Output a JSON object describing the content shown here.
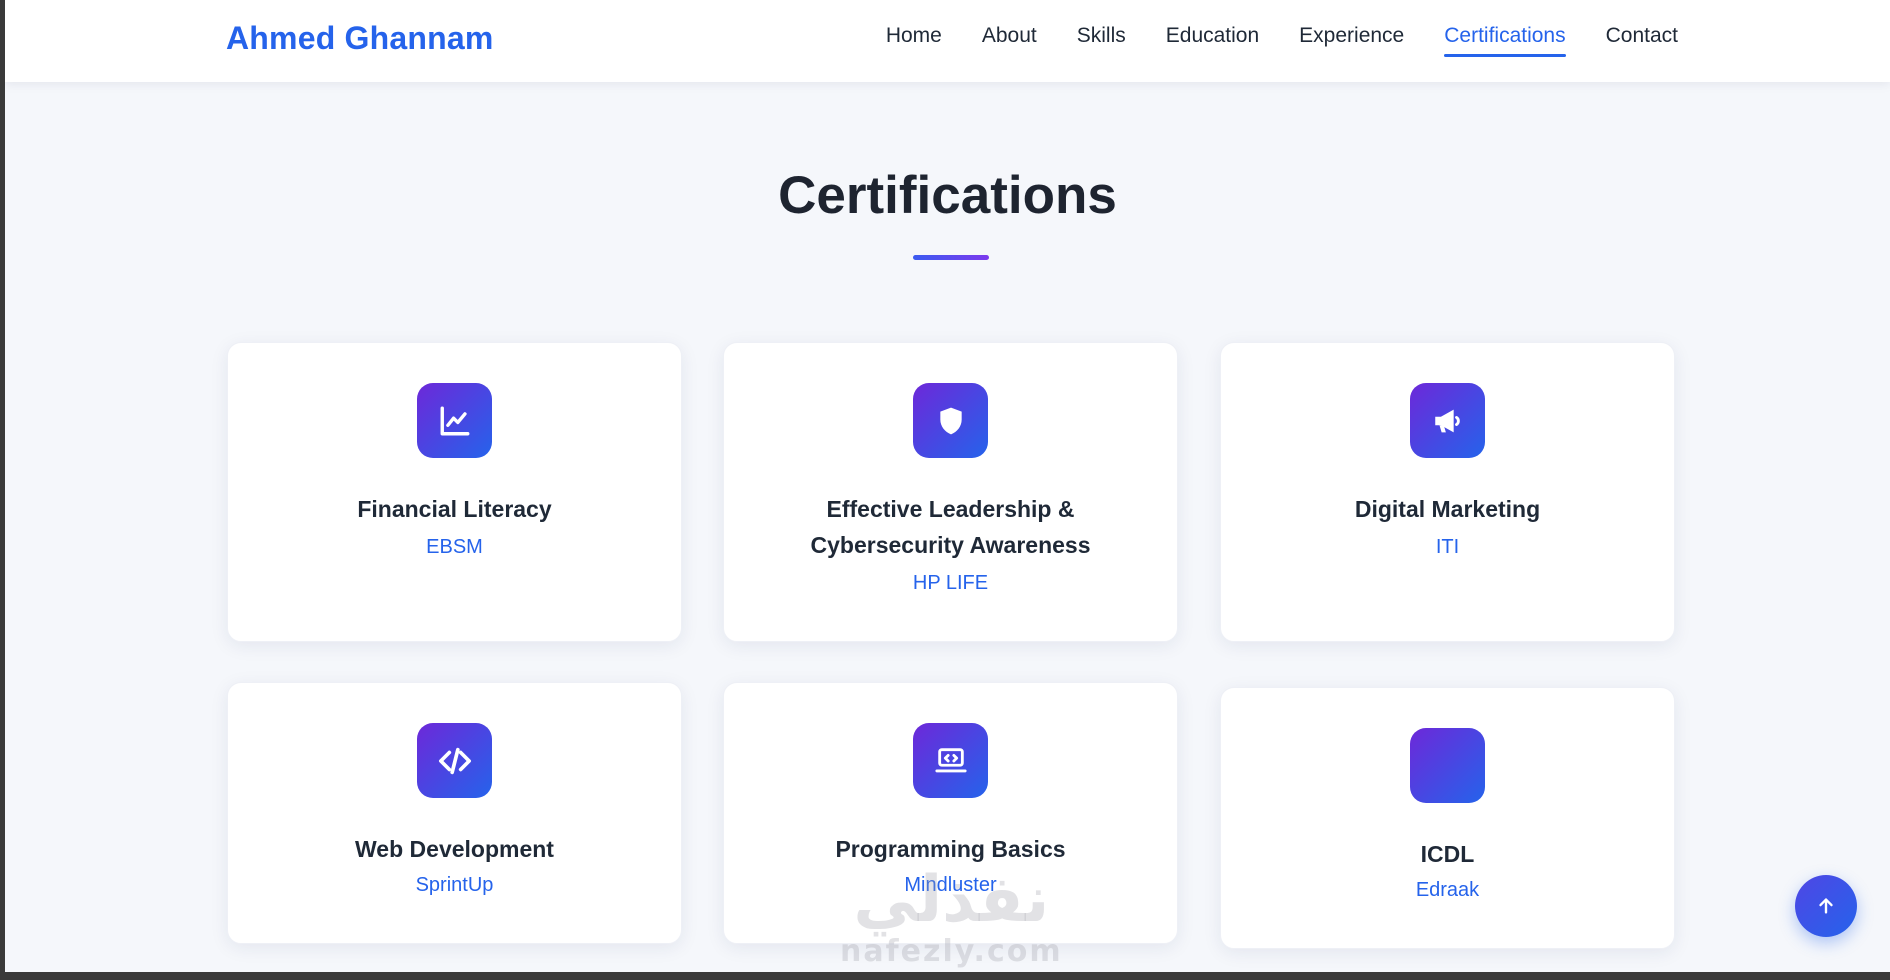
{
  "brand": {
    "name": "Ahmed Ghannam",
    "color": "#2563eb"
  },
  "nav": {
    "items": [
      {
        "label": "Home",
        "active": false
      },
      {
        "label": "About",
        "active": false
      },
      {
        "label": "Skills",
        "active": false
      },
      {
        "label": "Education",
        "active": false
      },
      {
        "label": "Experience",
        "active": false
      },
      {
        "label": "Certifications",
        "active": true
      },
      {
        "label": "Contact",
        "active": false
      }
    ]
  },
  "section": {
    "title": "Certifications"
  },
  "certifications": [
    {
      "title": "Financial Literacy",
      "issuer": "EBSM",
      "icon": "chart-line-icon"
    },
    {
      "title": "Effective Leadership & Cybersecurity Awareness",
      "issuer": "HP LIFE",
      "icon": "shield-icon"
    },
    {
      "title": "Digital Marketing",
      "issuer": "ITI",
      "icon": "megaphone-icon"
    },
    {
      "title": "Web Development",
      "issuer": "SprintUp",
      "icon": "code-icon"
    },
    {
      "title": "Programming Basics",
      "issuer": "Mindluster",
      "icon": "laptop-code-icon"
    },
    {
      "title": "ICDL",
      "issuer": "Edraak",
      "icon": ""
    }
  ],
  "watermark": {
    "arabic": "نفذلي",
    "latin": "nafezly.com"
  },
  "scroll_top": {
    "icon": "arrow-up-icon"
  }
}
